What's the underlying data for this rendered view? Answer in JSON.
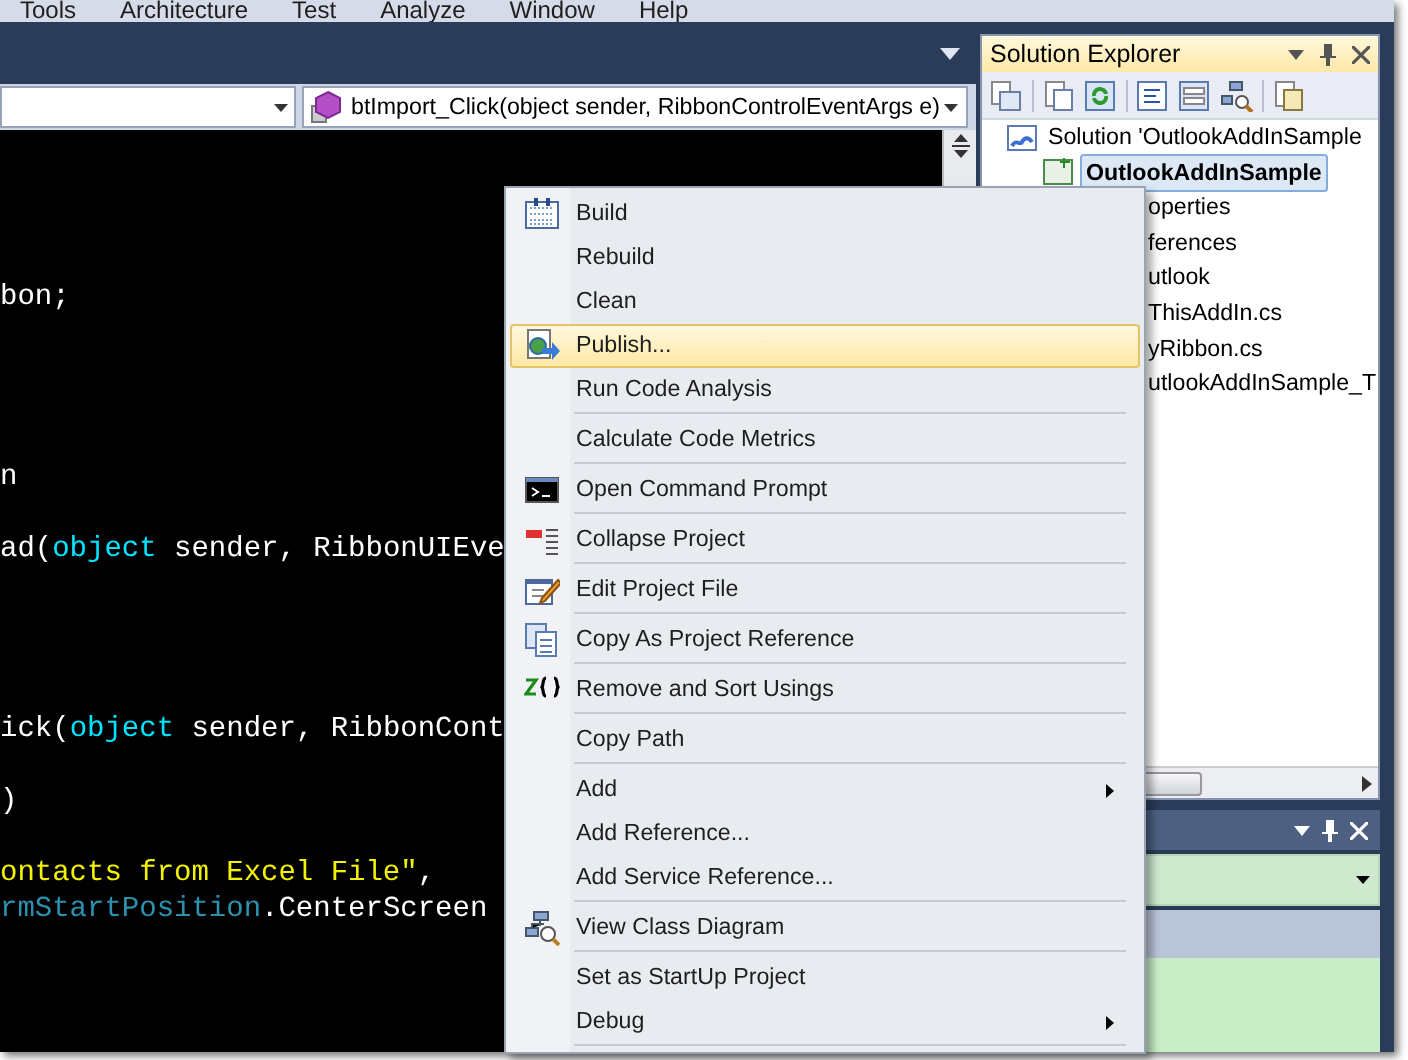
{
  "menu_bar": {
    "items": [
      "Tools",
      "Architecture",
      "Test",
      "Analyze",
      "Window",
      "Help"
    ]
  },
  "editor": {
    "member_combo": {
      "value": "btImport_Click(object sender, RibbonControlEventArgs e)"
    },
    "lines": [
      {
        "kind": "blank"
      },
      {
        "kind": "blank"
      },
      {
        "kind": "blank"
      },
      {
        "kind": "blank"
      },
      {
        "kind": "code",
        "tokens": [
          {
            "text": "bon;",
            "kind": "plain"
          }
        ]
      },
      {
        "kind": "blank"
      },
      {
        "kind": "blank"
      },
      {
        "kind": "blank"
      },
      {
        "kind": "blank"
      },
      {
        "kind": "code",
        "tokens": [
          {
            "text": "n",
            "kind": "plain"
          }
        ]
      },
      {
        "kind": "blank"
      },
      {
        "kind": "code",
        "tokens": [
          {
            "text": "ad(",
            "kind": "plain"
          },
          {
            "text": "object",
            "kind": "keyword"
          },
          {
            "text": " sender, RibbonUIEve",
            "kind": "plain"
          }
        ]
      },
      {
        "kind": "blank"
      },
      {
        "kind": "blank"
      },
      {
        "kind": "blank"
      },
      {
        "kind": "blank"
      },
      {
        "kind": "code",
        "tokens": [
          {
            "text": "ick(",
            "kind": "plain"
          },
          {
            "text": "object",
            "kind": "keyword"
          },
          {
            "text": " sender, RibbonCont",
            "kind": "plain"
          }
        ]
      },
      {
        "kind": "blank"
      },
      {
        "kind": "code",
        "tokens": [
          {
            "text": ")",
            "kind": "plain"
          }
        ]
      },
      {
        "kind": "blank"
      },
      {
        "kind": "code",
        "tokens": [
          {
            "text": "ontacts from Excel File\"",
            "kind": "string"
          },
          {
            "text": ",",
            "kind": "plain"
          }
        ]
      },
      {
        "kind": "code",
        "tokens": [
          {
            "text": "rmStartPosition",
            "kind": "type"
          },
          {
            "text": ".CenterScreen",
            "kind": "plain"
          }
        ]
      }
    ]
  },
  "context_menu": {
    "items": [
      {
        "label": "Build",
        "selected": false,
        "separator_after": false,
        "submenu": false
      },
      {
        "label": "Rebuild",
        "selected": false,
        "separator_after": false,
        "submenu": false
      },
      {
        "label": "Clean",
        "selected": false,
        "separator_after": false,
        "submenu": false
      },
      {
        "label": "Publish...",
        "selected": true,
        "separator_after": false,
        "submenu": false
      },
      {
        "label": "Run Code Analysis",
        "selected": false,
        "separator_after": true,
        "submenu": false
      },
      {
        "label": "Calculate Code Metrics",
        "selected": false,
        "separator_after": true,
        "submenu": false
      },
      {
        "label": "Open Command Prompt",
        "selected": false,
        "separator_after": true,
        "submenu": false
      },
      {
        "label": "Collapse Project",
        "selected": false,
        "separator_after": true,
        "submenu": false
      },
      {
        "label": "Edit Project File",
        "selected": false,
        "separator_after": true,
        "submenu": false
      },
      {
        "label": "Copy As Project Reference",
        "selected": false,
        "separator_after": true,
        "submenu": false
      },
      {
        "label": "Remove and Sort Usings",
        "selected": false,
        "separator_after": true,
        "submenu": false
      },
      {
        "label": "Copy Path",
        "selected": false,
        "separator_after": true,
        "submenu": false
      },
      {
        "label": "Add",
        "selected": false,
        "separator_after": false,
        "submenu": true
      },
      {
        "label": "Add Reference...",
        "selected": false,
        "separator_after": false,
        "submenu": false
      },
      {
        "label": "Add Service Reference...",
        "selected": false,
        "separator_after": true,
        "submenu": false
      },
      {
        "label": "View Class Diagram",
        "selected": false,
        "separator_after": true,
        "submenu": false
      },
      {
        "label": "Set as StartUp Project",
        "selected": false,
        "separator_after": false,
        "submenu": false
      },
      {
        "label": "Debug",
        "selected": false,
        "separator_after": true,
        "submenu": true
      }
    ]
  },
  "solution_explorer": {
    "title": "Solution Explorer",
    "tree": [
      {
        "label": "Solution 'OutlookAddInSample",
        "selected": false,
        "children": [
          {
            "label": "OutlookAddInSample",
            "selected": true,
            "children": [
              {
                "label": "operties",
                "selected": false
              },
              {
                "label": "ferences",
                "selected": false
              },
              {
                "label": "utlook",
                "selected": false
              },
              {
                "label": "ThisAddIn.cs",
                "selected": false
              },
              {
                "label": "yRibbon.cs",
                "selected": false
              },
              {
                "label": "utlookAddInSample_T",
                "selected": false
              }
            ]
          }
        ]
      }
    ]
  }
}
